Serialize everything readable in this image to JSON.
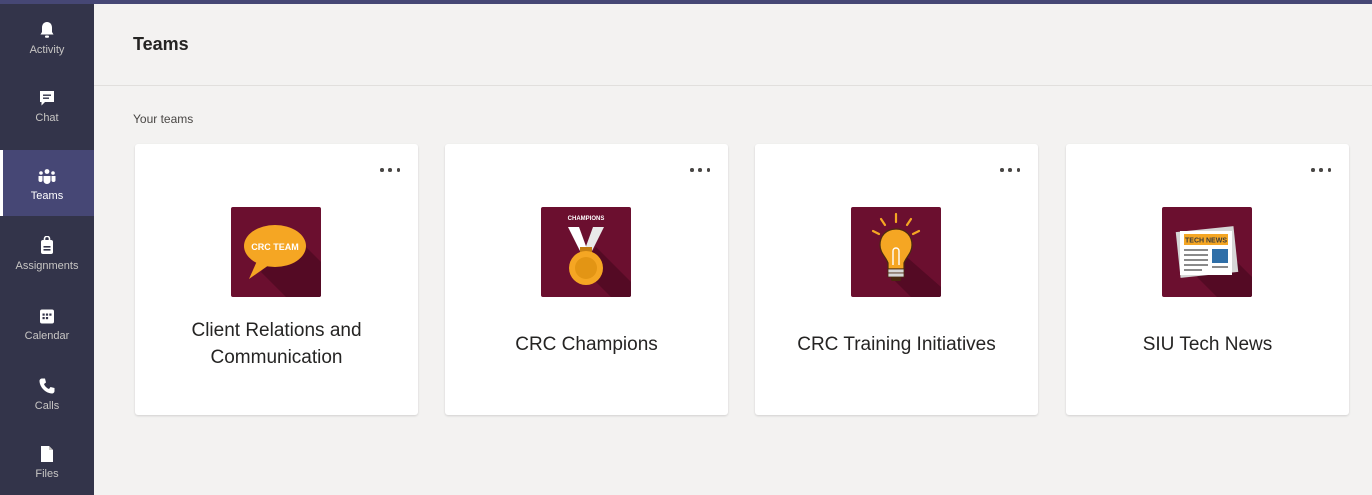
{
  "rail": {
    "items": [
      {
        "label": "Activity",
        "icon": "bell-icon"
      },
      {
        "label": "Chat",
        "icon": "chat-icon"
      },
      {
        "label": "Teams",
        "icon": "teams-icon",
        "active": true
      },
      {
        "label": "Assignments",
        "icon": "assignments-icon"
      },
      {
        "label": "Calendar",
        "icon": "calendar-icon"
      },
      {
        "label": "Calls",
        "icon": "phone-icon"
      },
      {
        "label": "Files",
        "icon": "file-icon"
      }
    ]
  },
  "header": {
    "title": "Teams"
  },
  "section": {
    "label": "Your teams"
  },
  "teams": [
    {
      "name": "Client Relations and Communication",
      "avatar_text": "CRC TEAM",
      "icon": "speech-bubble-icon"
    },
    {
      "name": "CRC Champions",
      "avatar_text": "CHAMPIONS",
      "icon": "medal-icon"
    },
    {
      "name": "CRC Training Initiatives",
      "icon": "lightbulb-icon"
    },
    {
      "name": "SIU Tech News",
      "avatar_text": "TECH NEWS",
      "icon": "newspaper-icon"
    }
  ],
  "colors": {
    "rail_bg": "#33344a",
    "rail_active": "#464775",
    "avatar_bg": "#6b0f2f",
    "avatar_accent": "#f5a623"
  }
}
